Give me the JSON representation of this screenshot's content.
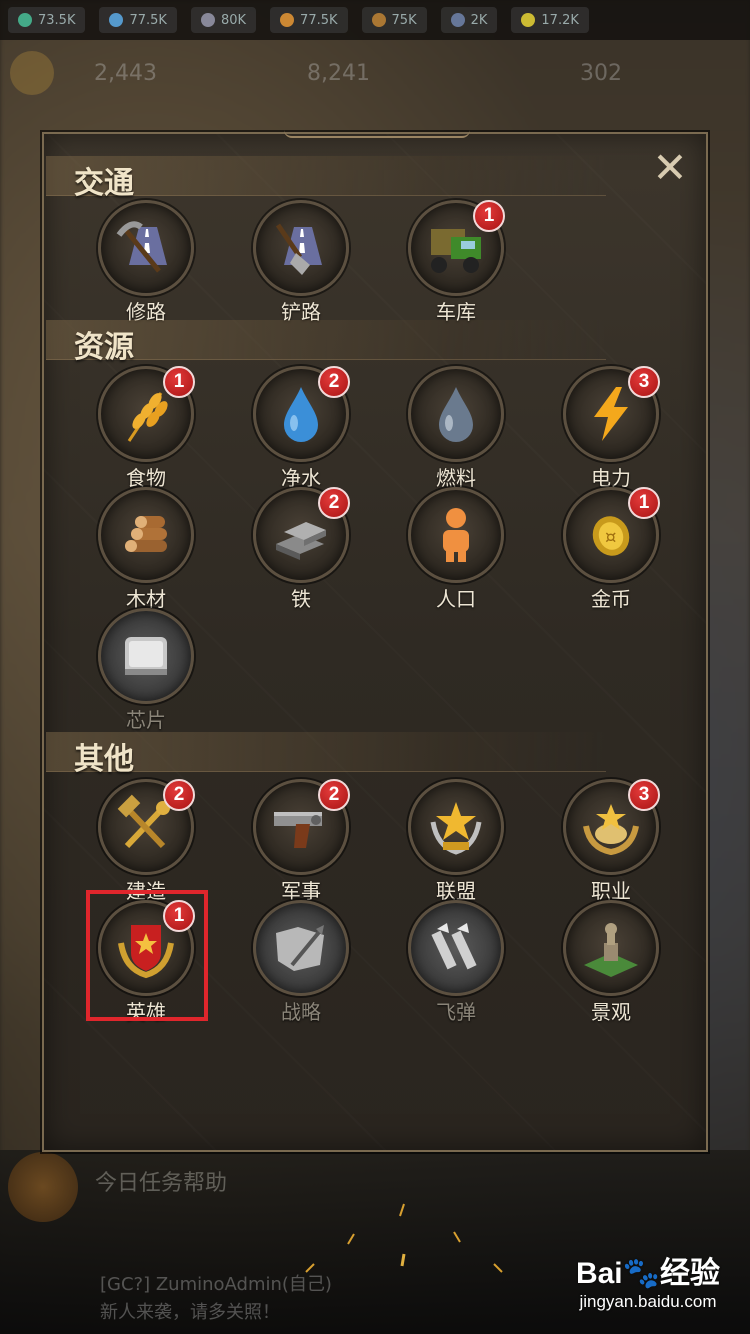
{
  "background": {
    "top_resources": [
      "73.5K",
      "77.5K",
      "80K",
      "77.5K",
      "75K",
      "2K",
      "17.2K"
    ],
    "second_bar": [
      "2,443",
      "8,241",
      "302"
    ],
    "tip_text": "今日任务帮助",
    "chat_line1": "[GC?] ZuminoAdmin(自己)",
    "chat_line2": "新人来袭，请多关照！"
  },
  "panel": {
    "close_symbol": "✕",
    "sections": [
      {
        "title": "交通",
        "items": [
          {
            "label": "修路",
            "badge": "",
            "icon": "pickaxe-road-icon",
            "dim": false
          },
          {
            "label": "铲路",
            "badge": "",
            "icon": "shovel-road-icon",
            "dim": false
          },
          {
            "label": "车库",
            "badge": "1",
            "icon": "truck-icon",
            "dim": false
          }
        ]
      },
      {
        "title": "资源",
        "items": [
          {
            "label": "食物",
            "badge": "1",
            "icon": "wheat-icon",
            "dim": false
          },
          {
            "label": "净水",
            "badge": "2",
            "icon": "water-drop-icon",
            "dim": false
          },
          {
            "label": "燃料",
            "badge": "",
            "icon": "fuel-drop-icon",
            "dim": false
          },
          {
            "label": "电力",
            "badge": "3",
            "icon": "lightning-icon",
            "dim": false
          },
          {
            "label": "木材",
            "badge": "",
            "icon": "wood-logs-icon",
            "dim": false
          },
          {
            "label": "铁",
            "badge": "2",
            "icon": "iron-bars-icon",
            "dim": false
          },
          {
            "label": "人口",
            "badge": "",
            "icon": "person-icon",
            "dim": false
          },
          {
            "label": "金币",
            "badge": "1",
            "icon": "gold-coin-icon",
            "dim": false
          },
          {
            "label": "芯片",
            "badge": "",
            "icon": "chip-icon",
            "dim": true
          }
        ]
      },
      {
        "title": "其他",
        "items": [
          {
            "label": "建造",
            "badge": "2",
            "icon": "tools-icon",
            "dim": false
          },
          {
            "label": "军事",
            "badge": "2",
            "icon": "pistol-icon",
            "dim": false
          },
          {
            "label": "联盟",
            "badge": "",
            "icon": "star-laurel-icon",
            "dim": false
          },
          {
            "label": "职业",
            "badge": "3",
            "icon": "career-emblem-icon",
            "dim": false
          },
          {
            "label": "英雄",
            "badge": "1",
            "icon": "hero-shield-icon",
            "dim": false
          },
          {
            "label": "战略",
            "badge": "",
            "icon": "strategy-map-icon",
            "dim": true
          },
          {
            "label": "飞弹",
            "badge": "",
            "icon": "missile-icon",
            "dim": true
          },
          {
            "label": "景观",
            "badge": "",
            "icon": "statue-icon",
            "dim": false
          }
        ]
      }
    ]
  },
  "highlight": {
    "target": "英雄",
    "color": "#e0262c"
  },
  "watermark": {
    "main": "Bai🐾经验",
    "sub": "jingyan.baidu.com"
  }
}
